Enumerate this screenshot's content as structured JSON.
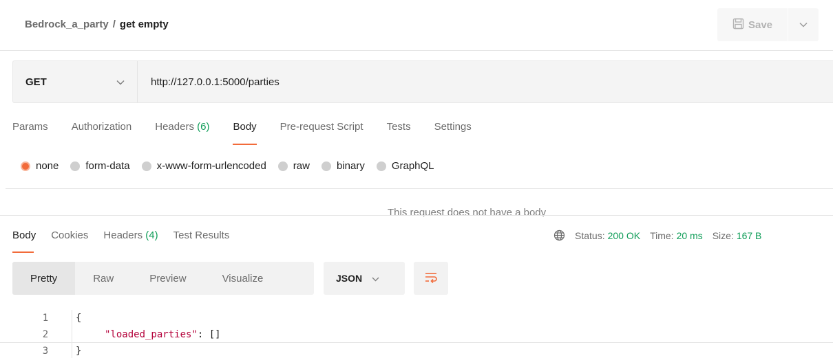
{
  "header": {
    "collection": "Bedrock_a_party",
    "separator": "/",
    "request_name": "get empty",
    "save_label": "Save"
  },
  "request": {
    "method": "GET",
    "url": "http://127.0.0.1:5000/parties"
  },
  "request_tabs": {
    "params": "Params",
    "authorization": "Authorization",
    "headers_label": "Headers",
    "headers_count": "(6)",
    "body": "Body",
    "prerequest": "Pre-request Script",
    "tests": "Tests",
    "settings": "Settings"
  },
  "body_types": {
    "none": "none",
    "form_data": "form-data",
    "urlencoded": "x-www-form-urlencoded",
    "raw": "raw",
    "binary": "binary",
    "graphql": "GraphQL",
    "selected": "none"
  },
  "no_body_message": "This request does not have a body",
  "response_tabs": {
    "body": "Body",
    "cookies": "Cookies",
    "headers_label": "Headers",
    "headers_count": "(4)",
    "test_results": "Test Results"
  },
  "response_meta": {
    "status_label": "Status:",
    "status_value": "200 OK",
    "time_label": "Time:",
    "time_value": "20 ms",
    "size_label": "Size:",
    "size_value": "167 B"
  },
  "view_modes": {
    "pretty": "Pretty",
    "raw": "Raw",
    "preview": "Preview",
    "visualize": "Visualize",
    "format": "JSON"
  },
  "code": {
    "line_numbers": [
      "1",
      "2",
      "3"
    ],
    "open_brace": "{",
    "key": "\"loaded_parties\"",
    "rest": ": []",
    "close_brace": "}"
  },
  "colors": {
    "accent": "#f26b3a",
    "success": "#0f9d58",
    "json_key": "#b4003a"
  }
}
